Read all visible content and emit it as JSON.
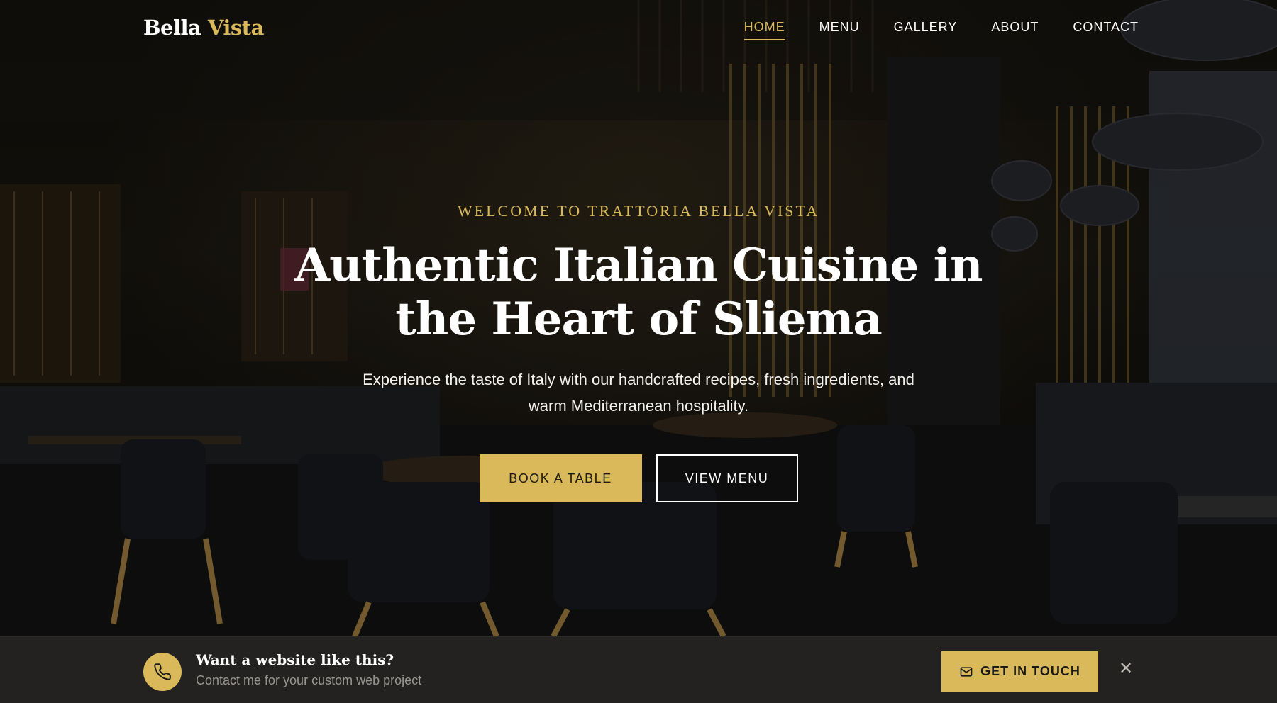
{
  "brand": {
    "name_first": "Bella",
    "name_second": "Vista"
  },
  "nav": {
    "items": [
      {
        "label": "HOME",
        "active": true
      },
      {
        "label": "MENU",
        "active": false
      },
      {
        "label": "GALLERY",
        "active": false
      },
      {
        "label": "ABOUT",
        "active": false
      },
      {
        "label": "CONTACT",
        "active": false
      }
    ]
  },
  "hero": {
    "eyebrow": "WELCOME TO TRATTORIA BELLA VISTA",
    "headline_line1": "Authentic Italian Cuisine in",
    "headline_line2": "the Heart of Sliema",
    "subtext_line1": "Experience the taste of Italy with our handcrafted recipes, fresh ingredients, and",
    "subtext_line2": "warm Mediterranean hospitality.",
    "primary_cta": "BOOK A TABLE",
    "secondary_cta": "VIEW MENU",
    "background": "restaurant-interior-photo"
  },
  "promo": {
    "title": "Want a website like this?",
    "subtitle": "Contact me for your custom web project",
    "button_label": "GET IN TOUCH",
    "phone_icon": "phone-icon",
    "mail_icon": "mail-icon",
    "close_icon": "close-icon"
  },
  "colors": {
    "accent": "#d9b95a",
    "promo_bg": "#232221",
    "text": "#ffffff"
  }
}
